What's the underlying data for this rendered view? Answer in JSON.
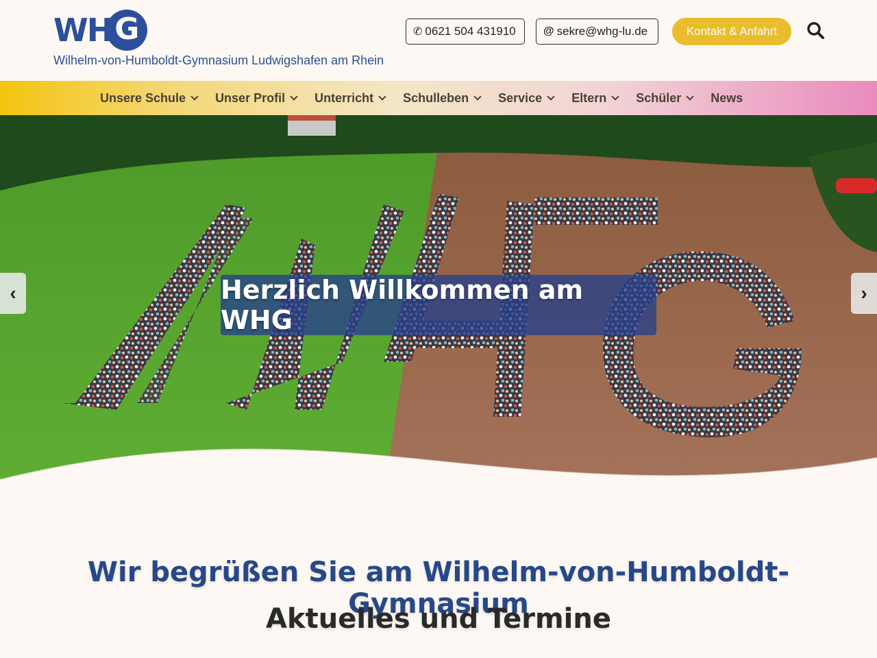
{
  "header": {
    "logo_text": "WH",
    "logo_letter": "G",
    "school_name": "Wilhelm-von-Humboldt-Gymnasium Ludwigshafen am Rhein",
    "phone": "0621 504 431910",
    "email": "sekre@whg-lu.de",
    "contact_label": "Kontakt & Anfahrt"
  },
  "nav": {
    "items": [
      {
        "label": "Unsere Schule",
        "dropdown": true
      },
      {
        "label": "Unser Profil",
        "dropdown": true
      },
      {
        "label": "Unterricht",
        "dropdown": true
      },
      {
        "label": "Schulleben",
        "dropdown": true
      },
      {
        "label": "Service",
        "dropdown": true
      },
      {
        "label": "Eltern",
        "dropdown": true
      },
      {
        "label": "Schüler",
        "dropdown": true
      },
      {
        "label": "News",
        "dropdown": false
      }
    ]
  },
  "hero": {
    "caption": "Herzlich Willkommen am WHG",
    "prev_label": "‹",
    "next_label": "›"
  },
  "content": {
    "welcome": "Wir begrüßen Sie am Wilhelm-von-Humboldt-Gymnasium",
    "news_part1": "Aktuelles",
    "news_part2": " und ",
    "news_part3": "Termine"
  },
  "colors": {
    "brand_blue": "#2b4f9b",
    "accent_yellow": "#e9bd2d",
    "nav_pink": "#e98bbd"
  }
}
